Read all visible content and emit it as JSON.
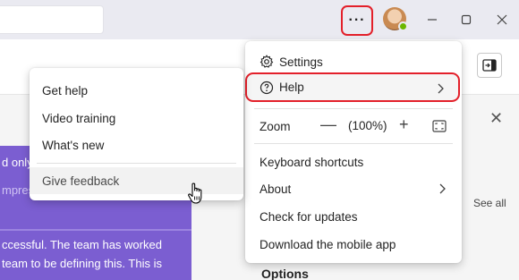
{
  "titlebar": {
    "more_label": "···",
    "more_icon": "ellipsis-icon",
    "avatar_icon": "user-avatar",
    "presence_color": "#6bb700",
    "minimize_icon": "minimize-icon",
    "maximize_icon": "maximize-icon",
    "close_icon": "close-icon"
  },
  "background": {
    "close_glyph": "✕",
    "see_all": "See all",
    "purple_lines": [
      "d only",
      "mpres",
      "ccessful. The team has worked",
      "team to be defining this. This is"
    ],
    "options_heading": "Options",
    "accent_color": "#7b5ed1"
  },
  "main_menu": {
    "settings": "Settings",
    "help": "Help",
    "zoom": "Zoom",
    "zoom_out": "—",
    "zoom_level": "(100%)",
    "zoom_in": "+",
    "keyboard_shortcuts": "Keyboard shortcuts",
    "about": "About",
    "check_updates": "Check for updates",
    "download_mobile": "Download the mobile app",
    "highlight_color": "#e3202a"
  },
  "help_submenu": {
    "get_help": "Get help",
    "video_training": "Video training",
    "whats_new": "What's new",
    "give_feedback": "Give feedback"
  }
}
